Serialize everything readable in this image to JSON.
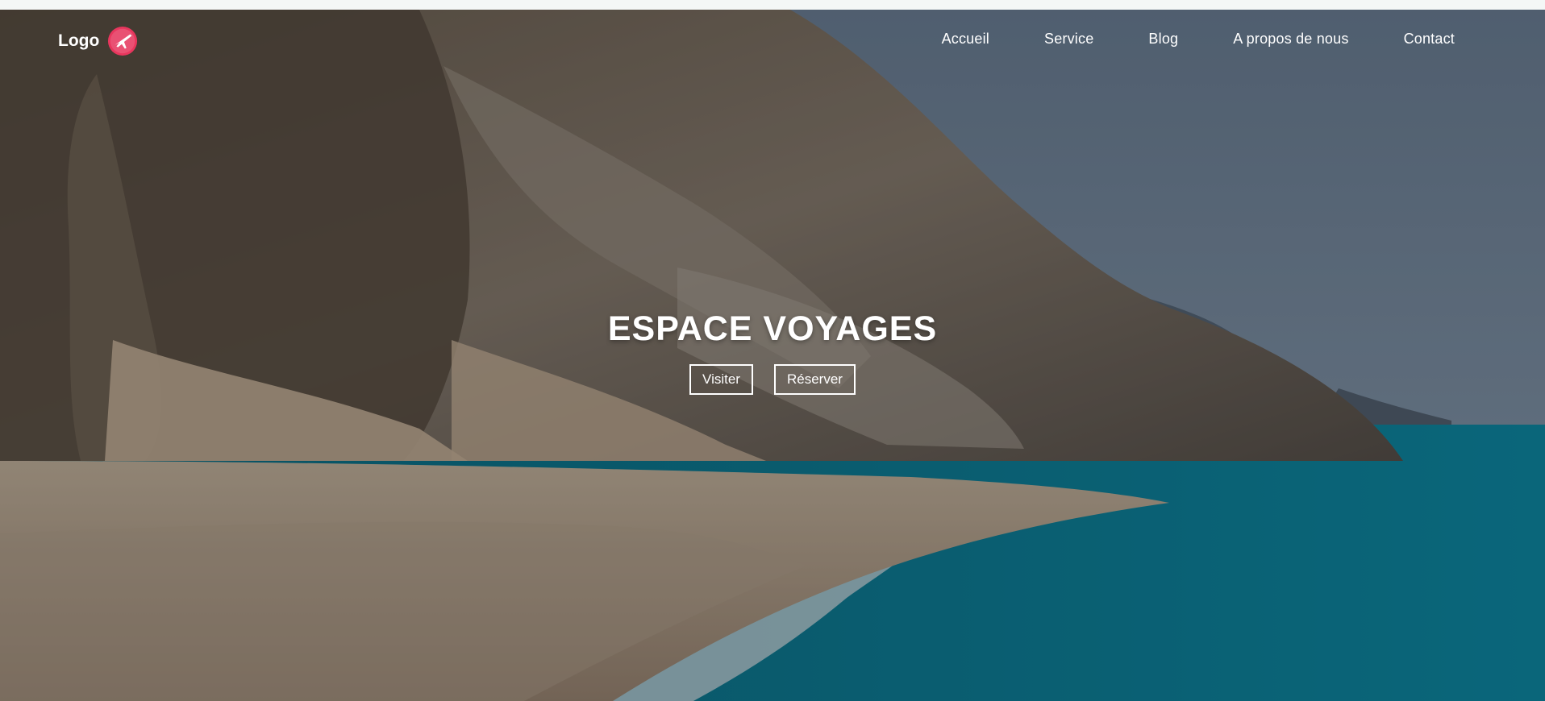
{
  "nav": {
    "logo_text": "Logo",
    "logo_icon": "airplane-badge-icon",
    "items": [
      {
        "label": "Accueil"
      },
      {
        "label": "Service"
      },
      {
        "label": "Blog"
      },
      {
        "label": "A propos de nous"
      },
      {
        "label": "Contact"
      }
    ]
  },
  "hero": {
    "title": "ESPACE VOYAGES",
    "primary_button": "Visiter",
    "secondary_button": "Réserver"
  },
  "colors": {
    "overlay": "#000000",
    "sea": "#0f7f97",
    "sky": "#5b6e84",
    "logo_badge": "#e8365d",
    "text": "#ffffff"
  }
}
